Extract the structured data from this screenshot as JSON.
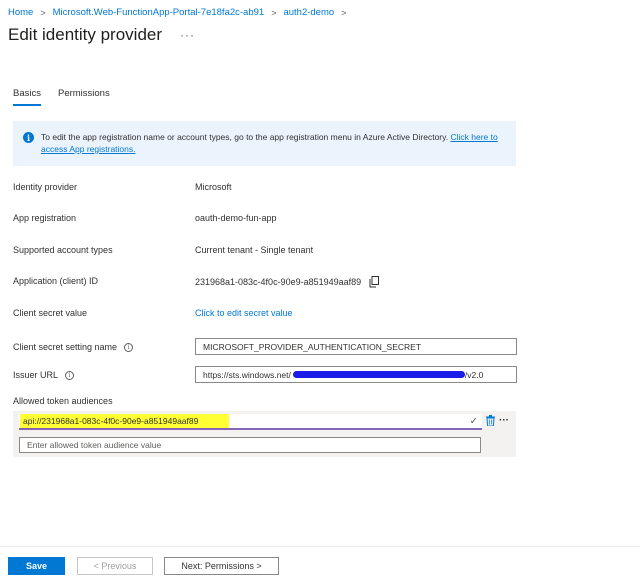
{
  "breadcrumb": {
    "items": [
      "Home",
      "Microsoft.Web-FunctionApp-Portal-7e18fa2c-ab91",
      "auth2-demo"
    ],
    "separator": ">"
  },
  "page": {
    "title": "Edit identity provider",
    "more_label": "···"
  },
  "tabs": [
    {
      "label": "Basics",
      "active": true
    },
    {
      "label": "Permissions",
      "active": false
    }
  ],
  "info": {
    "text": "To edit the app registration name or account types, go to the app registration menu in Azure Active Directory. ",
    "link_text": "Click here to access App registrations."
  },
  "fields": {
    "identity_provider": {
      "label": "Identity provider",
      "value": "Microsoft"
    },
    "app_registration": {
      "label": "App registration",
      "value": "oauth-demo-fun-app"
    },
    "account_types": {
      "label": "Supported account types",
      "value": "Current tenant - Single tenant"
    },
    "client_id": {
      "label": "Application (client) ID",
      "value": "231968a1-083c-4f0c-90e9-a851949aaf89"
    },
    "client_secret": {
      "label": "Client secret value",
      "value": "Click to edit secret value"
    },
    "secret_setting": {
      "label": "Client secret setting name",
      "value": "MICROSOFT_PROVIDER_AUTHENTICATION_SECRET"
    },
    "issuer_url": {
      "label": "Issuer URL",
      "value_prefix": "https://sts.windows.net/",
      "value_suffix": "/v2.0"
    }
  },
  "audiences": {
    "label": "Allowed token audiences",
    "items": [
      "api://231968a1-083c-4f0c-90e9-a851949aaf89"
    ],
    "placeholder": "Enter allowed token audience value"
  },
  "footer": {
    "save_label": "Save",
    "previous_label": "< Previous",
    "next_label": "Next: Permissions >"
  },
  "colors": {
    "accent": "#0078d4",
    "highlight": "#ffff33",
    "redaction": "#1c1ce8"
  }
}
